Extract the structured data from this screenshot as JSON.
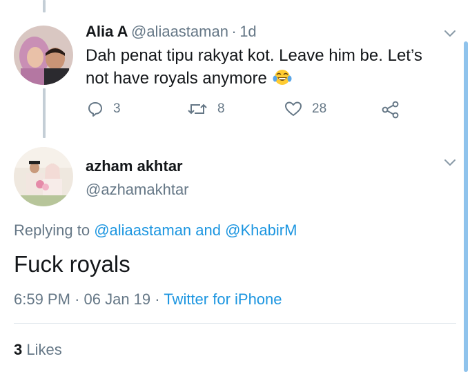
{
  "colors": {
    "accent": "#1b95e0",
    "muted": "#657786",
    "text": "#14171a",
    "thread_line": "#c4ced6"
  },
  "parent_tweet": {
    "author_name": "Alia A",
    "handle": "@aliaastaman",
    "separator": "·",
    "time_ago": "1d",
    "text_line1": "Dah penat tipu rakyat kot. Leave him be. Let’s",
    "text_line2": "not have royals anymore",
    "emoji_icon": "tears-of-joy-emoji-icon",
    "reply_count": "3",
    "retweet_count": "8",
    "like_count": "28"
  },
  "main_tweet": {
    "author_name": "azham akhtar",
    "handle": "@azhamakhtar",
    "replying_prefix": "Replying to",
    "reply_user1": "@aliaastaman",
    "reply_and": "and",
    "reply_user2": "@KhabirM",
    "text": "Fuck royals",
    "time": "6:59 PM",
    "sep1": "·",
    "date": "06 Jan 19",
    "sep2": "·",
    "source": "Twitter for iPhone",
    "likes_count": "3",
    "likes_label": "Likes"
  }
}
